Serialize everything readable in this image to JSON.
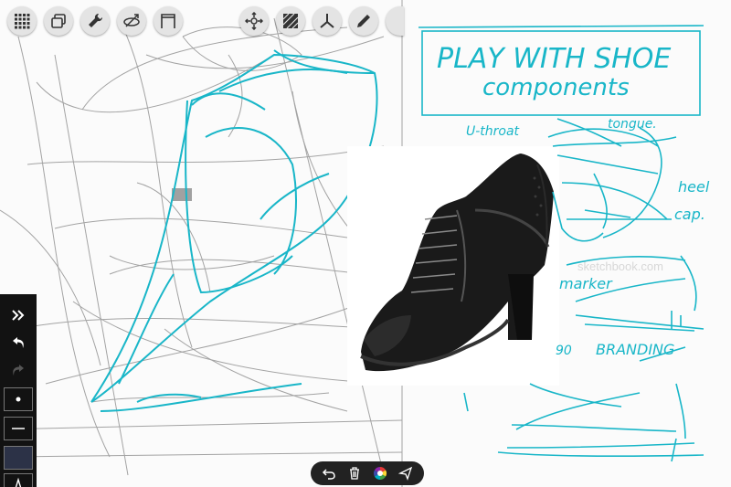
{
  "app": {
    "toolbar_left": [
      {
        "icon": "grid-menu-icon"
      },
      {
        "icon": "layers-icon"
      },
      {
        "icon": "wrench-icon"
      },
      {
        "icon": "perspective-icon"
      },
      {
        "icon": "frame-icon"
      }
    ],
    "toolbar_right": [
      {
        "icon": "transform-icon"
      },
      {
        "icon": "hatch-fill-icon"
      },
      {
        "icon": "symmetry-icon"
      },
      {
        "icon": "pen-tool-icon"
      }
    ]
  },
  "canvas": {
    "title_line1": "PLAY WITH SHOE",
    "title_line2": "components",
    "labels": {
      "throat": "U-throat",
      "tongue": "tongue.",
      "heel": "heel",
      "cap": "cap.",
      "marker": "marker",
      "branding": "BRANDING",
      "branding_prefix": "90"
    },
    "watermark": "sketchbook.com",
    "colors": {
      "ink_cyan": "#19b6c8",
      "pencil_grey": "#9a9a9a"
    }
  },
  "side_panel": {
    "items": [
      {
        "icon": "expand-chevrons-icon"
      },
      {
        "icon": "undo-icon"
      },
      {
        "icon": "redo-icon"
      },
      {
        "icon": "brush-dot-icon"
      },
      {
        "icon": "brush-line-icon"
      },
      {
        "icon": "color-swatch-icon"
      },
      {
        "icon": "text-tool-icon"
      }
    ]
  },
  "bottom_bar": {
    "items": [
      {
        "icon": "undo-arrow-icon"
      },
      {
        "icon": "trash-icon"
      },
      {
        "icon": "color-wheel-icon"
      },
      {
        "icon": "send-icon"
      }
    ]
  }
}
